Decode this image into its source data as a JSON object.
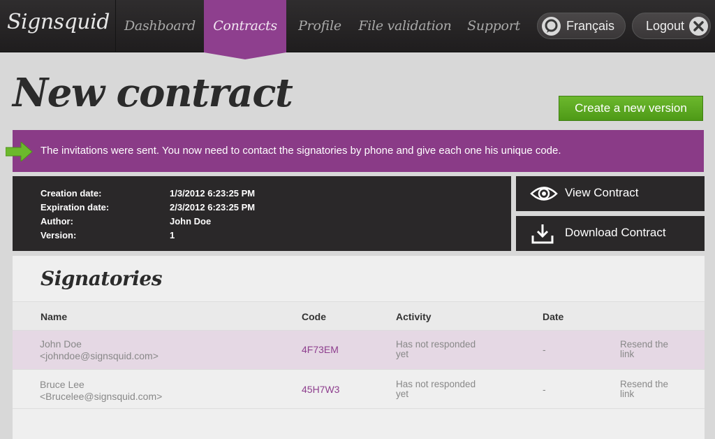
{
  "app": {
    "logo": "Signsquid"
  },
  "nav": {
    "items": [
      {
        "label": "Dashboard",
        "active": false
      },
      {
        "label": "Contracts",
        "active": true
      },
      {
        "label": "Profile",
        "active": false
      },
      {
        "label": "File validation",
        "active": false
      },
      {
        "label": "Support",
        "active": false
      }
    ],
    "language_label": "Français",
    "logout_label": "Logout"
  },
  "page": {
    "title": "New contract",
    "create_version_label": "Create a new version",
    "notice": "The invitations were sent. You now need to contact the signatories by phone and give each one his unique code."
  },
  "meta": {
    "rows": [
      {
        "label": "Creation date:",
        "value": "1/3/2012 6:23:25 PM"
      },
      {
        "label": "Expiration date:",
        "value": "2/3/2012 6:23:25 PM"
      },
      {
        "label": "Author:",
        "value": "John Doe"
      },
      {
        "label": "Version:",
        "value": "1"
      }
    ]
  },
  "actions": {
    "view_label": "View Contract",
    "download_label": "Download Contract"
  },
  "signatories": {
    "title": "Signatories",
    "columns": {
      "name": "Name",
      "code": "Code",
      "activity": "Activity",
      "date": "Date"
    },
    "rows": [
      {
        "name": "John Doe",
        "email": "<johndoe@signsquid.com>",
        "code": "4F73EM",
        "activity_1": "Has not responded",
        "activity_2": "yet",
        "date": "-",
        "resend_1": "Resend the",
        "resend_2": "link"
      },
      {
        "name": "Bruce Lee",
        "email": "<Brucelee@signsquid.com>",
        "code": "45H7W3",
        "activity_1": "Has not responded",
        "activity_2": "yet",
        "date": "-",
        "resend_1": "Resend the",
        "resend_2": "link"
      }
    ]
  },
  "colors": {
    "accent": "#8e3f8e",
    "notice": "#8a3b87",
    "green": "#5aa71f",
    "dark": "#2a2829"
  }
}
